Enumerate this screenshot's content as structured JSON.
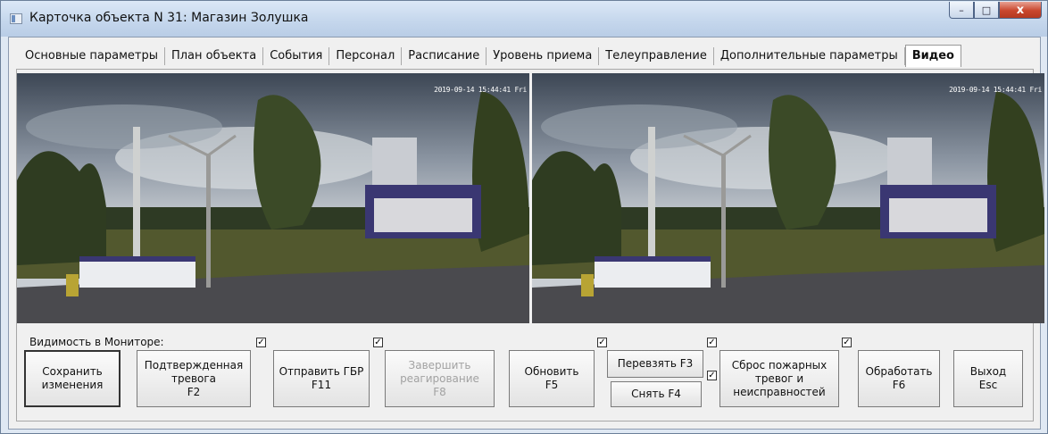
{
  "window": {
    "title": "Карточка объекта N 31: Магазин Золушка",
    "minimize_label": "–",
    "maximize_label": "□",
    "close_label": "x"
  },
  "tabs": [
    {
      "label": "Основные параметры",
      "active": false
    },
    {
      "label": "План объекта",
      "active": false
    },
    {
      "label": "События",
      "active": false
    },
    {
      "label": "Персонал",
      "active": false
    },
    {
      "label": "Расписание",
      "active": false
    },
    {
      "label": "Уровень приема",
      "active": false
    },
    {
      "label": "Телеуправление",
      "active": false
    },
    {
      "label": "Дополнительные параметры",
      "active": false
    },
    {
      "label": "Видео",
      "active": true
    }
  ],
  "video": {
    "camera1_timestamp": "2019-09-14 15:44:41 Fri",
    "camera2_timestamp": "2019-09-14 15:44:41 Fri"
  },
  "controls": {
    "visibility_label": "Видимость в Мониторе:",
    "check_mark": "✓",
    "buttons": {
      "save": "Сохранить\nизменения",
      "confirmed_alarm": "Подтвержденная\nтревога\nF2",
      "send_gbr": "Отправить ГБР\nF11",
      "finish_response": "Завершить\nреагирование\nF8",
      "refresh": "Обновить\nF5",
      "rearm": "Перевзять F3",
      "disarm": "Снять F4",
      "reset_fire": "Сброс пожарных\nтревог и\nнеисправностей",
      "process": "Обработать\nF6",
      "exit": "Выход\nEsc"
    }
  }
}
